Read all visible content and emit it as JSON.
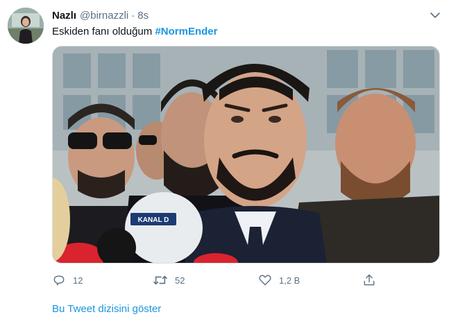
{
  "tweet": {
    "author_name": "Nazlı",
    "handle": "@birnazzli",
    "separator": "·",
    "time": "8s",
    "text": "Eskiden fanı olduğum",
    "hashtag": "#NormEnder",
    "media_caption": "KANAL D",
    "actions": {
      "reply_count": "12",
      "retweet_count": "52",
      "like_count": "1,2 B"
    },
    "show_thread_label": "Bu Tweet dizisini göster"
  },
  "colors": {
    "link": "#1b95e0",
    "muted": "#5b7083",
    "text": "#0f1419"
  }
}
